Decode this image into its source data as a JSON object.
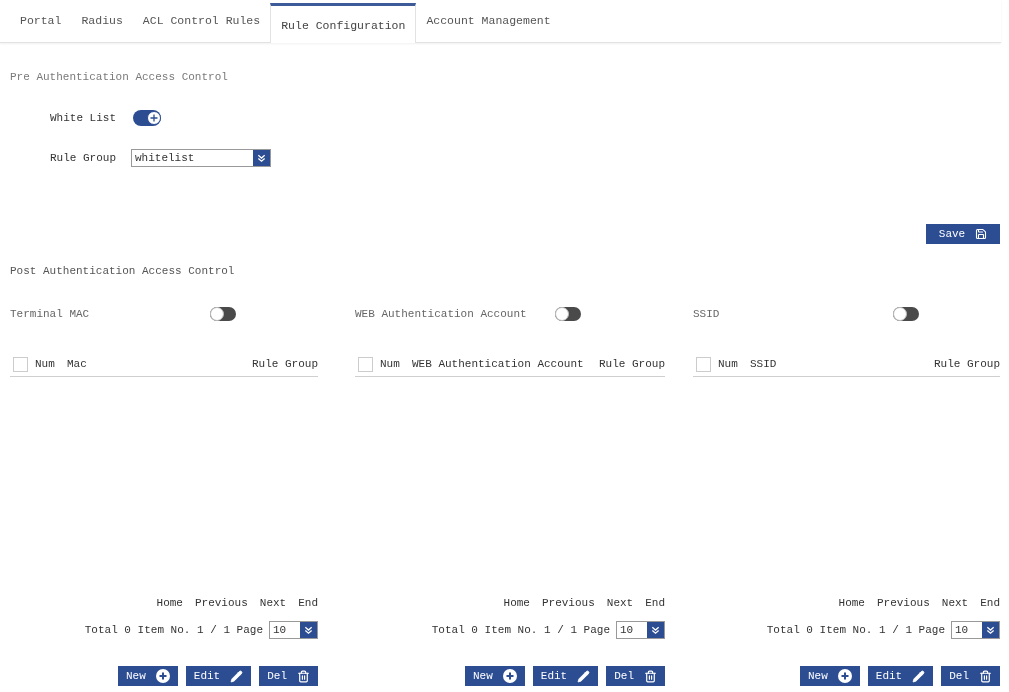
{
  "tabs": [
    {
      "label": "Portal",
      "selected": false
    },
    {
      "label": "Radius",
      "selected": false
    },
    {
      "label": "ACL Control Rules",
      "selected": false
    },
    {
      "label": "Rule Configuration",
      "selected": true
    },
    {
      "label": "Account Management",
      "selected": false
    }
  ],
  "pre_auth": {
    "title": "Pre Authentication Access Control",
    "white_list": {
      "label": "White List",
      "on": true
    },
    "rule_group": {
      "label": "Rule Group",
      "value": "whitelist"
    },
    "save_button": {
      "label": "Save"
    }
  },
  "post_auth": {
    "title": "Post Authentication Access Control",
    "panels": [
      {
        "label": "Terminal MAC",
        "on": false,
        "select_all": {
          "checked": false
        },
        "columns": [
          "Num",
          "Mac",
          "Rule Group"
        ],
        "pagination": {
          "links": [
            "Home",
            "Previous",
            "Next",
            "End"
          ],
          "summary": "Total 0 Item No. 1 / 1 Page",
          "page_size": "10"
        },
        "buttons": [
          {
            "kind": "new",
            "label": "New"
          },
          {
            "kind": "edit",
            "label": "Edit"
          },
          {
            "kind": "delete",
            "label": "Del"
          }
        ]
      },
      {
        "label": "WEB Authentication Account",
        "on": false,
        "select_all": {
          "checked": false
        },
        "columns": [
          "Num",
          "WEB Authentication Account",
          "Rule Group"
        ],
        "pagination": {
          "links": [
            "Home",
            "Previous",
            "Next",
            "End"
          ],
          "summary": "Total 0 Item No. 1 / 1 Page",
          "page_size": "10"
        },
        "buttons": [
          {
            "kind": "new",
            "label": "New"
          },
          {
            "kind": "edit",
            "label": "Edit"
          },
          {
            "kind": "delete",
            "label": "Del"
          }
        ]
      },
      {
        "label": "SSID",
        "on": false,
        "select_all": {
          "checked": false
        },
        "columns": [
          "Num",
          "SSID",
          "Rule Group"
        ],
        "pagination": {
          "links": [
            "Home",
            "Previous",
            "Next",
            "End"
          ],
          "summary": "Total 0 Item No. 1 / 1 Page",
          "page_size": "10"
        },
        "buttons": [
          {
            "kind": "new",
            "label": "New"
          },
          {
            "kind": "edit",
            "label": "Edit"
          },
          {
            "kind": "delete",
            "label": "Del"
          }
        ]
      }
    ]
  }
}
